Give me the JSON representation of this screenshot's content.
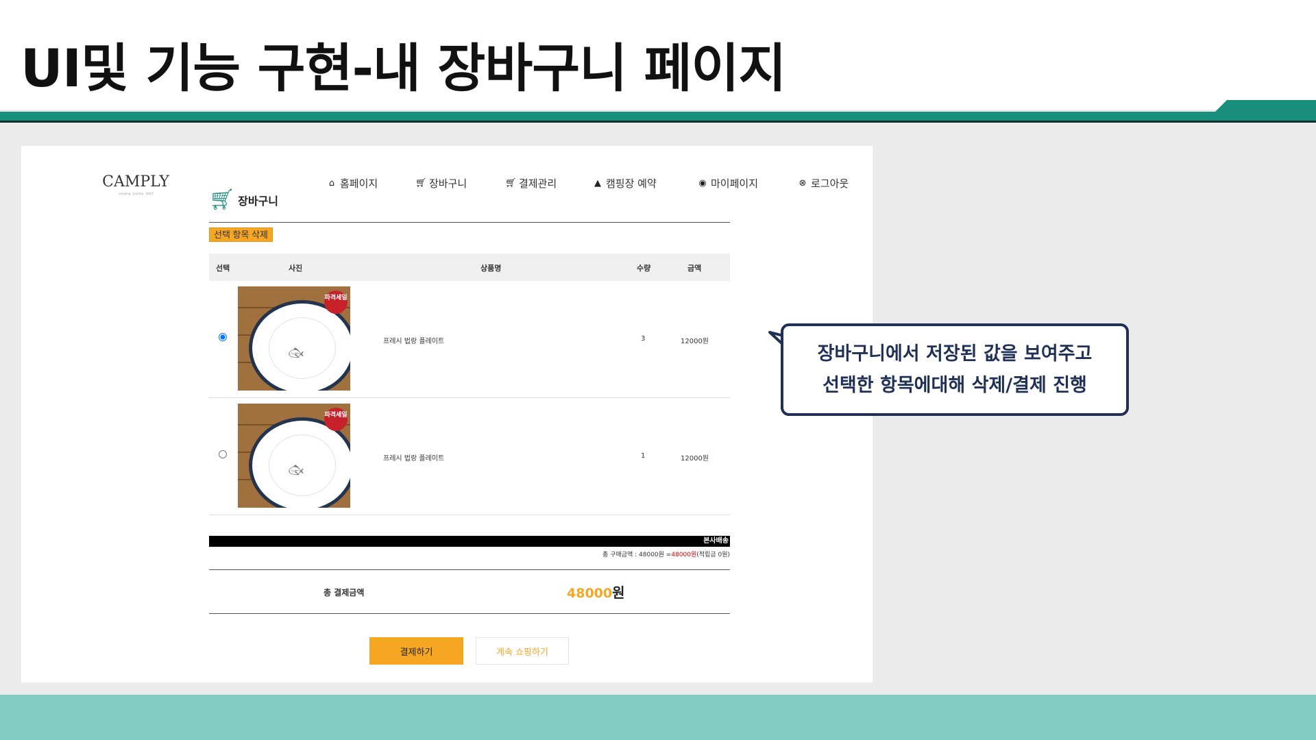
{
  "slide": {
    "title": "UI및 기능 구현-내 장바구니 페이지"
  },
  "app": {
    "logo": "CAMPLY",
    "logo_sub": "camping · journey · 2024",
    "nav": [
      {
        "icon": "home-icon",
        "label": "홈페이지"
      },
      {
        "icon": "cart-icon",
        "label": "장바구니"
      },
      {
        "icon": "cart-icon",
        "label": "결제관리"
      },
      {
        "icon": "tent-icon",
        "label": "캠핑장 예약"
      },
      {
        "icon": "user-icon",
        "label": "마이페이지"
      },
      {
        "icon": "close-circle-icon",
        "label": "로그아웃"
      }
    ],
    "page_heading": "장바구니",
    "delete_button": "선택 항목 삭제",
    "table": {
      "headers": [
        "선택",
        "사진",
        "상품명",
        "수량",
        "금액"
      ],
      "rows": [
        {
          "selected": true,
          "badge": "파격세일",
          "name": "프레시 법랑 플레이트",
          "qty": "3",
          "price": "12000원"
        },
        {
          "selected": false,
          "badge": "파격세일",
          "name": "프레시 법랑 플레이트",
          "qty": "1",
          "price": "12000원"
        }
      ]
    },
    "shipping_label": "본사배송",
    "summary": {
      "prefix": "총 구매금액 : 48000원 =",
      "highlight": "48000원",
      "suffix": "(적립금 0원)"
    },
    "total": {
      "label": "총 결제금액",
      "amount": "48000",
      "unit": "원"
    },
    "pay_button": "결제하기",
    "continue_button": "계속 쇼핑하기"
  },
  "callout": {
    "line1": "장바구니에서 저장된 값을 보여주고",
    "line2": "선택한 항목에대해 삭제/결제 진행"
  },
  "colors": {
    "accent_teal": "#1b8f7e",
    "footer_teal": "#82cbc2",
    "accent_orange": "#f5a623",
    "callout_navy": "#1f3057"
  }
}
